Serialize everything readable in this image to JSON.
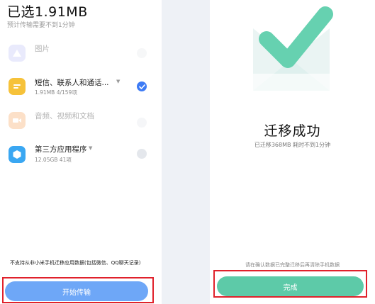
{
  "left": {
    "title": "已选1.91MB",
    "subtitle": "预计传输需要不到1分钟",
    "items": [
      {
        "label": "图片",
        "meta": "",
        "enabled": false,
        "checked": false,
        "icon": "image-icon",
        "color": "#c3c6f7"
      },
      {
        "label": "短信、联系人和通话...",
        "meta": "1.91MB  4/159项",
        "enabled": true,
        "checked": true,
        "icon": "chat-icon",
        "color": "#f6c23a"
      },
      {
        "label": "音频、视频和文档",
        "meta": "",
        "enabled": false,
        "checked": false,
        "icon": "video-icon",
        "color": "#f8a765"
      },
      {
        "label": "第三方应用程序",
        "meta": "12.05GB  41项",
        "enabled": true,
        "checked": false,
        "icon": "app-icon",
        "color": "#3aa7f2"
      }
    ],
    "note": "不支持从非小米手机迁移应用数据(包括微信、QQ聊天记录)",
    "start_label": "开始传输"
  },
  "right": {
    "title": "迁移成功",
    "subtitle": "已迁移368MB 耗时不到1分钟",
    "tip": "请在确认数据已完整迁移后再清除手机数据",
    "done_label": "完成"
  },
  "colors": {
    "accent_blue": "#3d7bf5",
    "start_button": "#6ea7f7",
    "done_button": "#5dcaa8",
    "highlight": "#e0212b"
  }
}
